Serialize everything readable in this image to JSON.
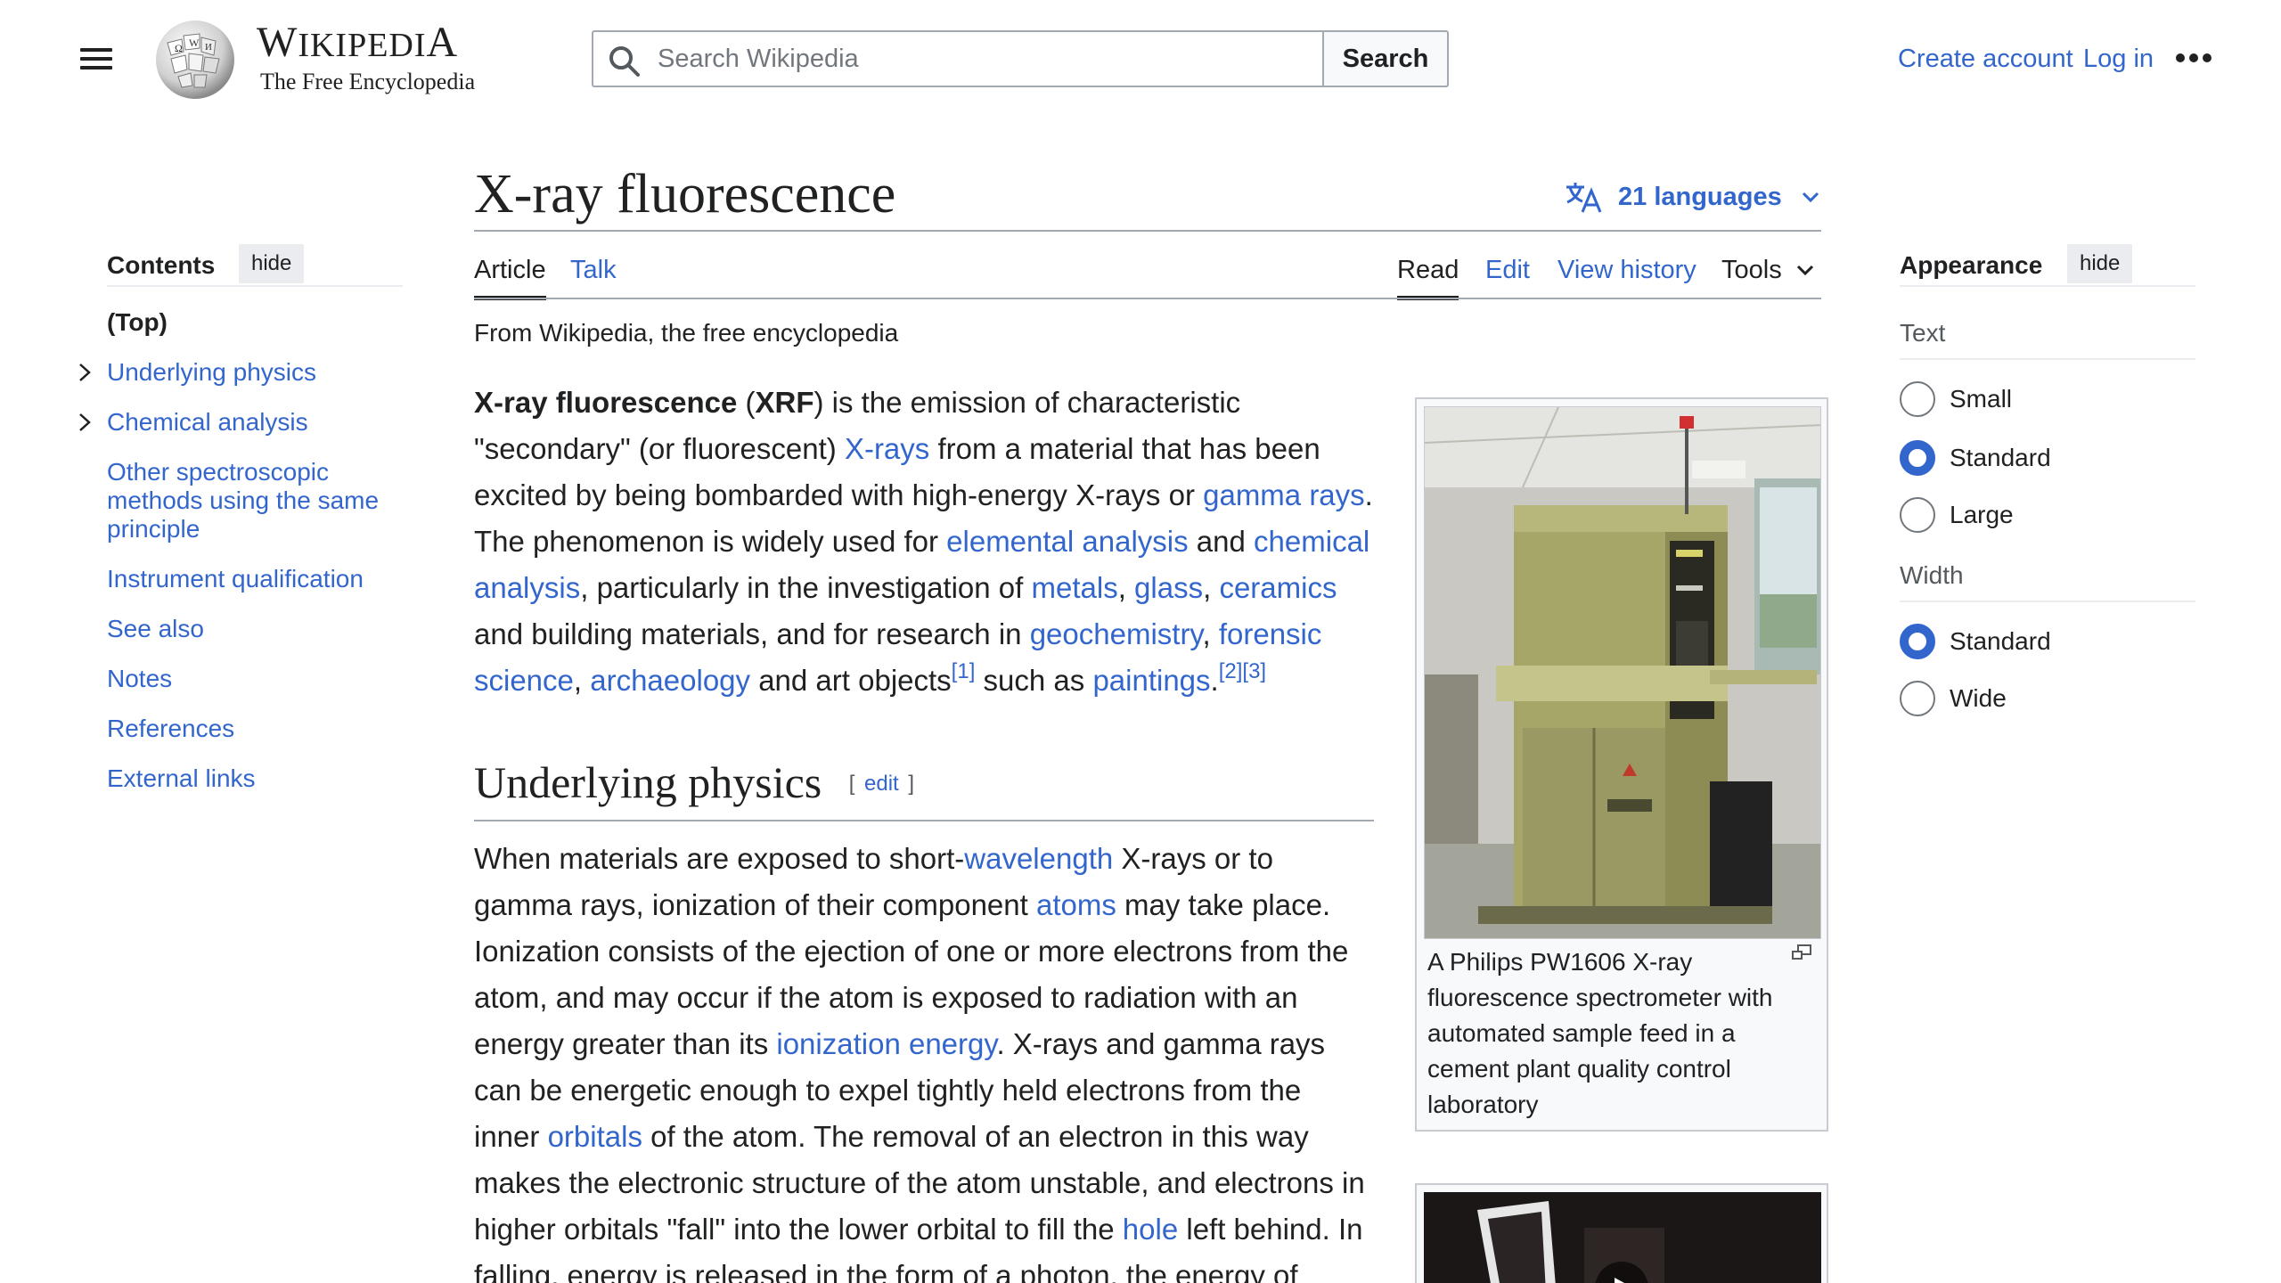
{
  "header": {
    "wordmark_title_first": "W",
    "wordmark_title_rest": "IKIPEDI",
    "wordmark_title_last": "A",
    "wordmark_tagline": "The Free Encyclopedia",
    "search_placeholder": "Search Wikipedia",
    "search_button": "Search",
    "create_account": "Create account",
    "log_in": "Log in"
  },
  "toc": {
    "title": "Contents",
    "hide": "hide",
    "items": [
      {
        "label": "(Top)"
      },
      {
        "label": "Underlying physics"
      },
      {
        "label": "Chemical analysis"
      },
      {
        "label": "Other spectroscopic methods using the same principle"
      },
      {
        "label": "Instrument qualification"
      },
      {
        "label": "See also"
      },
      {
        "label": "Notes"
      },
      {
        "label": "References"
      },
      {
        "label": "External links"
      }
    ]
  },
  "article": {
    "title": "X-ray fluorescence",
    "languages": "21 languages",
    "tabs": {
      "article": "Article",
      "talk": "Talk",
      "read": "Read",
      "edit": "Edit",
      "history": "View history",
      "tools": "Tools"
    },
    "tagline": "From Wikipedia, the free encyclopedia",
    "lead": {
      "t1": "X-ray fluorescence",
      "t2": " (",
      "t3": "XRF",
      "t4": ") is the emission of characteristic \"secondary\" (or fluorescent) ",
      "l1": "X-rays",
      "t5": " from a material that has been excited by being bombarded with high-energy X-rays or ",
      "l2": "gamma rays",
      "t6": ". The phenomenon is widely used for ",
      "l3": "elemental analysis",
      "t7": " and ",
      "l4": "chemical analysis",
      "t8": ", particularly in the investigation of ",
      "l5": "metals",
      "t9": ", ",
      "l6": "glass",
      "t10": ", ",
      "l7": "ceramics",
      "t11": " and building materials, and for research in ",
      "l8": "geochemistry",
      "t12": ", ",
      "l9": "forensic science",
      "t13": ", ",
      "l10": "archaeology",
      "t14": " and art objects",
      "r1": "[1]",
      "t15": " such as ",
      "l11": "paintings",
      "t16": ".",
      "r2": "[2]",
      "r3": "[3]"
    },
    "section1": {
      "heading": "Underlying physics",
      "edit_open": "[ ",
      "edit": "edit",
      "edit_close": " ]",
      "t1": "When materials are exposed to short-",
      "l1": "wavelength",
      "t2": " X-rays or to gamma rays, ionization of their component ",
      "l2": "atoms",
      "t3": " may take place. Ionization consists of the ejection of one or more electrons from the atom, and may occur if the atom is exposed to radiation with an energy greater than its ",
      "l3": "ionization energy",
      "t4": ". X-rays and gamma rays can be energetic enough to expel tightly held electrons from the inner ",
      "l4": "orbitals",
      "t5": " of the atom. The removal of an electron in this way makes the electronic structure of the atom unstable, and electrons in higher orbitals \"fall\" into the lower orbital to fill the ",
      "l5": "hole",
      "t6": " left behind. In falling, energy is released in the form of a photon, the energy of which is equal to the"
    },
    "figure": {
      "caption": "A Philips PW1606 X-ray fluorescence spectrometer with automated sample feed in a cement plant quality control laboratory"
    }
  },
  "appearance": {
    "title": "Appearance",
    "hide": "hide",
    "text_label": "Text",
    "text_options": [
      "Small",
      "Standard",
      "Large"
    ],
    "text_selected": "Standard",
    "width_label": "Width",
    "width_options": [
      "Standard",
      "Wide"
    ],
    "width_selected": "Standard"
  },
  "colors": {
    "link": "#3366cc",
    "text": "#202122",
    "border": "#a2a9b1"
  }
}
